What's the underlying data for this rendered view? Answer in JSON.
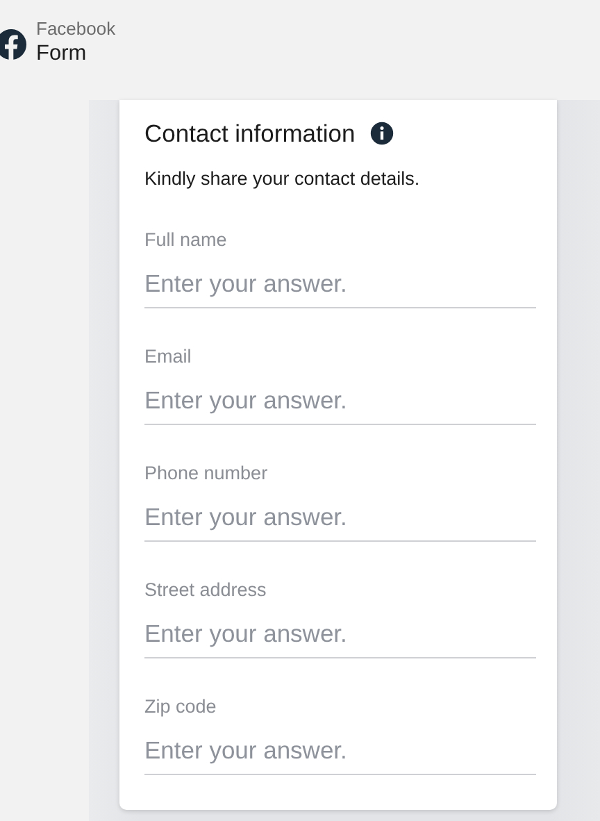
{
  "header": {
    "brand": "Facebook",
    "title": "Form"
  },
  "section": {
    "title": "Contact information",
    "description": "Kindly share your contact details."
  },
  "fields": [
    {
      "label": "Full name",
      "placeholder": "Enter your answer."
    },
    {
      "label": "Email",
      "placeholder": "Enter your answer."
    },
    {
      "label": "Phone number",
      "placeholder": "Enter your answer."
    },
    {
      "label": "Street address",
      "placeholder": "Enter your answer."
    },
    {
      "label": "Zip code",
      "placeholder": "Enter your answer."
    }
  ]
}
